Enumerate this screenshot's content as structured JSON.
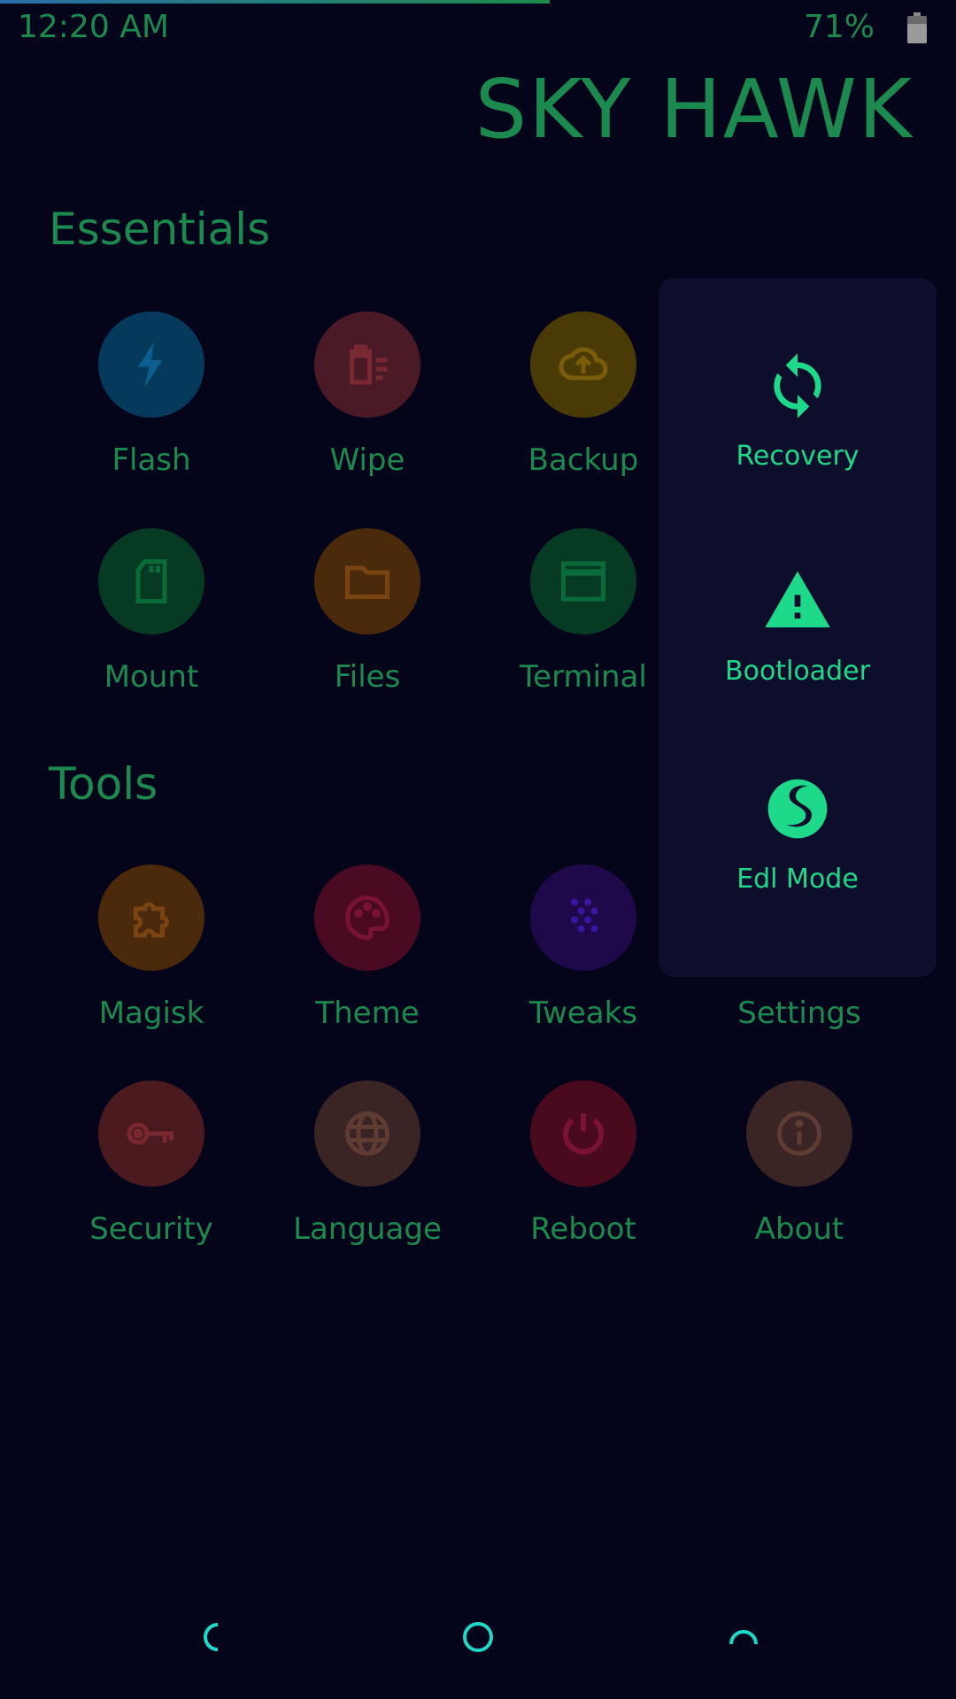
{
  "status": {
    "time": "12:20 AM",
    "battery": "71%",
    "progress": 0.575
  },
  "brand": "SKY HAWK",
  "sections": {
    "essentials": "Essentials",
    "tools": "Tools"
  },
  "tiles": {
    "flash": "Flash",
    "wipe": "Wipe",
    "backup": "Backup",
    "mount": "Mount",
    "files": "Files",
    "terminal": "Terminal",
    "magisk": "Magisk",
    "theme": "Theme",
    "tweaks": "Tweaks",
    "settings": "Settings",
    "security": "Security",
    "language": "Language",
    "reboot": "Reboot",
    "about": "About"
  },
  "reboot_menu": {
    "recovery": "Recovery",
    "bootloader": "Bootloader",
    "edl": "Edl Mode"
  },
  "icons": {
    "flash": "lightning-icon",
    "wipe": "trash-icon",
    "backup": "cloud-upload-icon",
    "mount": "sd-card-icon",
    "files": "folder-icon",
    "terminal": "window-icon",
    "magisk": "puzzle-icon",
    "theme": "palette-icon",
    "tweaks": "dots-grid-icon",
    "security": "key-icon",
    "language": "globe-icon",
    "reboot": "power-icon",
    "about": "info-icon",
    "recovery": "sync-icon",
    "bootloader": "warning-icon",
    "edl": "qualcomm-snapdragon-icon"
  },
  "colors": {
    "background": "#04041a",
    "text": "#1c8a4e",
    "accent": "#1fd98a",
    "panel": "#0c0e2c"
  }
}
